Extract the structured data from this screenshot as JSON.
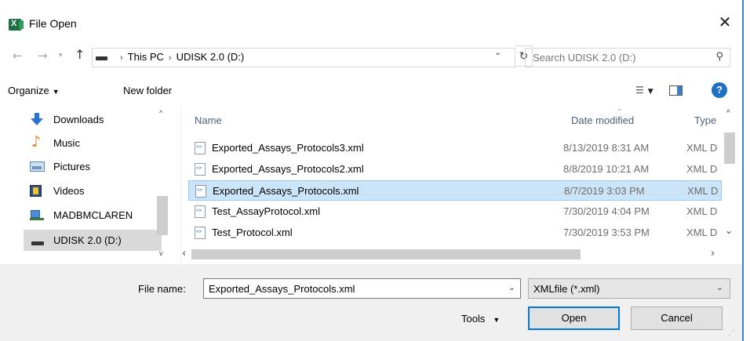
{
  "window": {
    "title": "File Open",
    "close_glyph": "✕"
  },
  "address": {
    "crumbs": [
      "This PC",
      "UDISK 2.0 (D:)"
    ],
    "search_placeholder": "Search UDISK 2.0 (D:)"
  },
  "toolbar": {
    "organize_label": "Organize",
    "new_folder_label": "New folder"
  },
  "nav_pane": {
    "items": [
      {
        "label": "Downloads",
        "icon": "downloads-icon"
      },
      {
        "label": "Music",
        "icon": "music-icon"
      },
      {
        "label": "Pictures",
        "icon": "pictures-icon"
      },
      {
        "label": "Videos",
        "icon": "videos-icon"
      },
      {
        "label": "MADBMCLAREN",
        "icon": "network-drive-icon"
      },
      {
        "label": "UDISK 2.0 (D:)",
        "icon": "usb-drive-icon",
        "selected": true
      },
      {
        "label": "",
        "icon": "drive-icon",
        "partial": true
      }
    ]
  },
  "file_list": {
    "columns": {
      "name": "Name",
      "date": "Date modified",
      "type": "Type"
    },
    "rows": [
      {
        "name": "Exported_Assays_Protocols3.xml",
        "date": "8/13/2019 8:31 AM",
        "type": "XML Document"
      },
      {
        "name": "Exported_Assays_Protocols2.xml",
        "date": "8/8/2019 10:21 AM",
        "type": "XML Document"
      },
      {
        "name": "Exported_Assays_Protocols.xml",
        "date": "8/7/2019 3:03 PM",
        "type": "XML Document",
        "selected": true
      },
      {
        "name": "Test_AssayProtocol.xml",
        "date": "7/30/2019 4:04 PM",
        "type": "XML Document"
      },
      {
        "name": "Test_Protocol.xml",
        "date": "7/30/2019 3:53 PM",
        "type": "XML Document"
      }
    ]
  },
  "bottom": {
    "file_name_label": "File name:",
    "file_name_value": "Exported_Assays_Protocols.xml",
    "file_type_value": "XMLfile (*.xml)",
    "tools_label": "Tools",
    "open_label": "Open",
    "cancel_label": "Cancel"
  },
  "colors": {
    "selection_bg": "#cce4f7",
    "accent": "#0078d7"
  }
}
